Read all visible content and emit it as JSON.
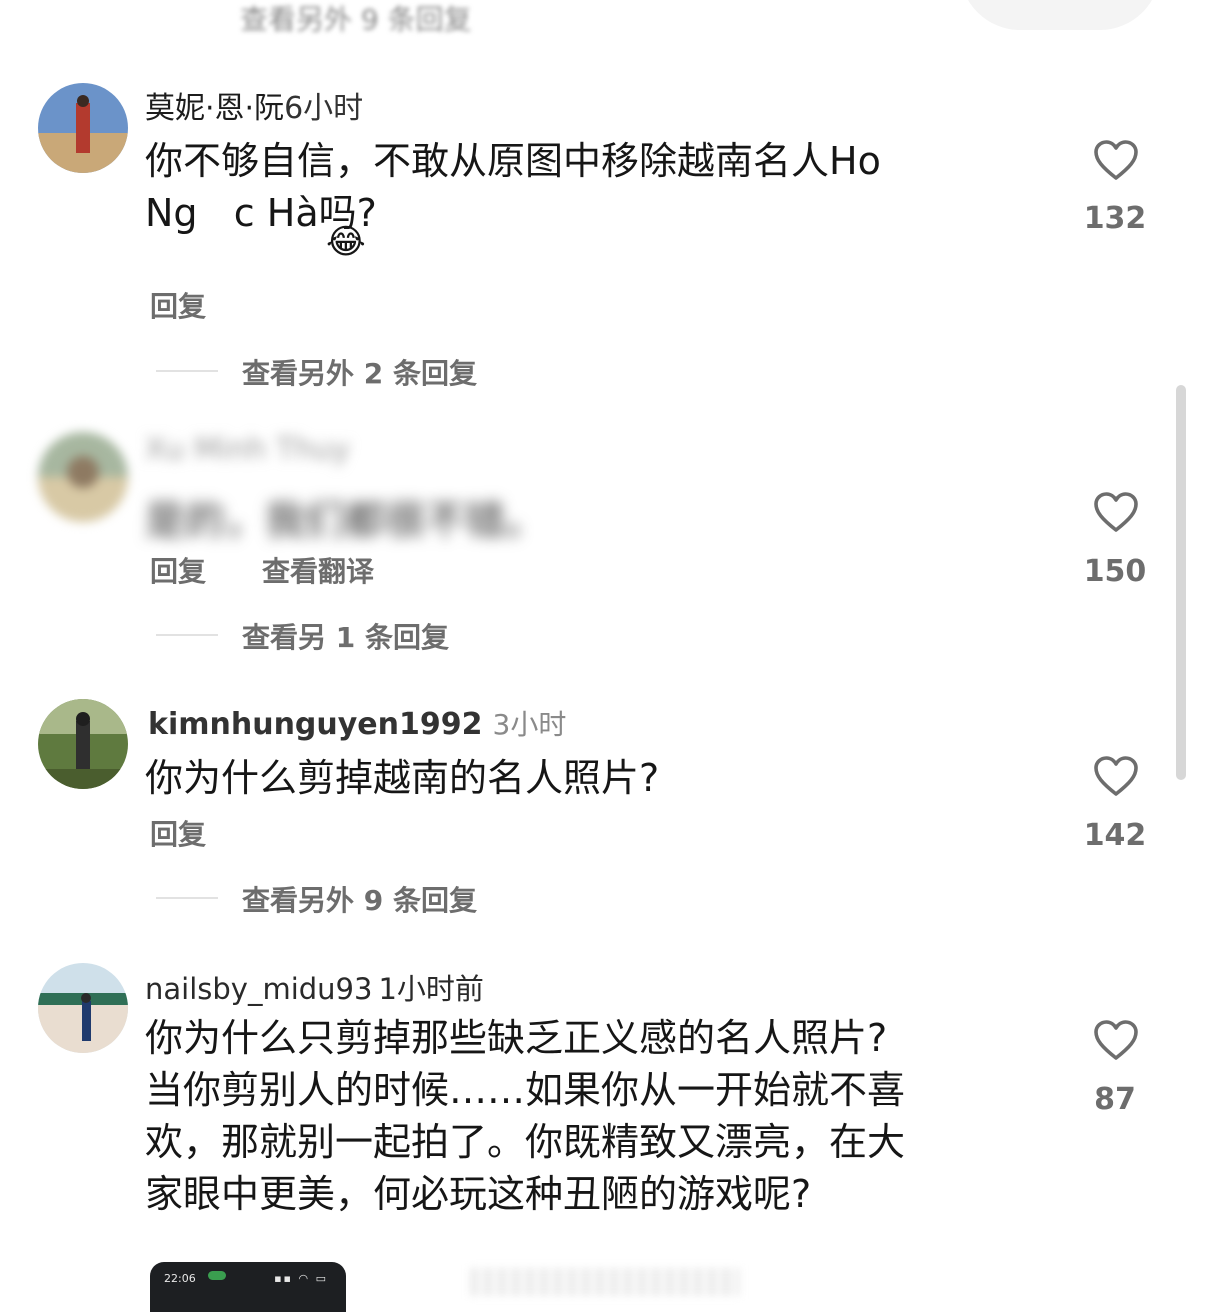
{
  "top_fragment": {
    "more_replies": "查看另外 9 条回复"
  },
  "comments": [
    {
      "name": "莫妮·恩·阮",
      "time": "6小时",
      "text_line1": "你不够自信，不敢从原图中移除越南名人Ho",
      "text_line2": "Ng   c Hà吗?",
      "emoji": "😂",
      "reply_label": "回复",
      "likes": "132",
      "more_replies": "查看另外 2 条回复"
    },
    {
      "name": "Xu Minh Thuy",
      "time": "",
      "text_line1": "是的，我们都很不错。",
      "reply_label": "回复",
      "translate_label": "查看翻译",
      "likes": "150",
      "more_replies": "查看另 1 条回复"
    },
    {
      "name": "kimnhunguyen1992",
      "time": "3小时",
      "text_line1": "你为什么剪掉越南的名人照片?",
      "reply_label": "回复",
      "likes": "142",
      "more_replies": "查看另外 9 条回复"
    },
    {
      "name": "nailsby_midu93",
      "time": "1小时前",
      "text_line1": "你为什么只剪掉那些缺乏正义感的名人照片?",
      "text_line2": "当你剪别人的时候……如果你从一开始就不喜",
      "text_line3": "欢，那就别一起拍了。你既精致又漂亮，在大",
      "text_line4": "家眼中更美，何必玩这种丑陋的游戏呢?",
      "likes": "87"
    }
  ],
  "thumbnail": {
    "clock": "22:06"
  },
  "colors": {
    "like_icon": "#6d6d6d",
    "secondary_text": "#6d6d6d",
    "primary_text": "#161616"
  },
  "icons": {
    "like": "heart-outline-icon"
  }
}
